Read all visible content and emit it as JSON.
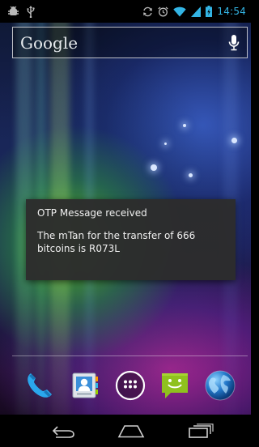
{
  "status_bar": {
    "time": "14:54",
    "left_icons": [
      "android-debug-icon",
      "usb-icon"
    ],
    "right_icons": [
      "sync-icon",
      "alarm-icon",
      "wifi-icon",
      "signal-icon",
      "battery-icon"
    ],
    "accent_color": "#33b5e5"
  },
  "search_widget": {
    "logo_text": "Google",
    "mic_icon": "microphone-icon"
  },
  "dialog": {
    "title": "OTP Message received",
    "body": "The mTan for the transfer of 666 bitcoins is R073L"
  },
  "dock": {
    "apps": [
      {
        "name": "phone",
        "icon": "phone-icon"
      },
      {
        "name": "contacts",
        "icon": "contacts-icon"
      },
      {
        "name": "apps",
        "icon": "app-drawer-icon"
      },
      {
        "name": "messaging",
        "icon": "messaging-icon"
      },
      {
        "name": "browser",
        "icon": "globe-icon"
      }
    ]
  },
  "nav_bar": {
    "buttons": [
      "back-icon",
      "home-icon",
      "recent-apps-icon"
    ]
  },
  "colors": {
    "dialog_background": "#2c2c2c",
    "status_time": "#33b5e5",
    "messaging_green": "#8fc11e",
    "phone_blue": "#2aa7ec"
  }
}
